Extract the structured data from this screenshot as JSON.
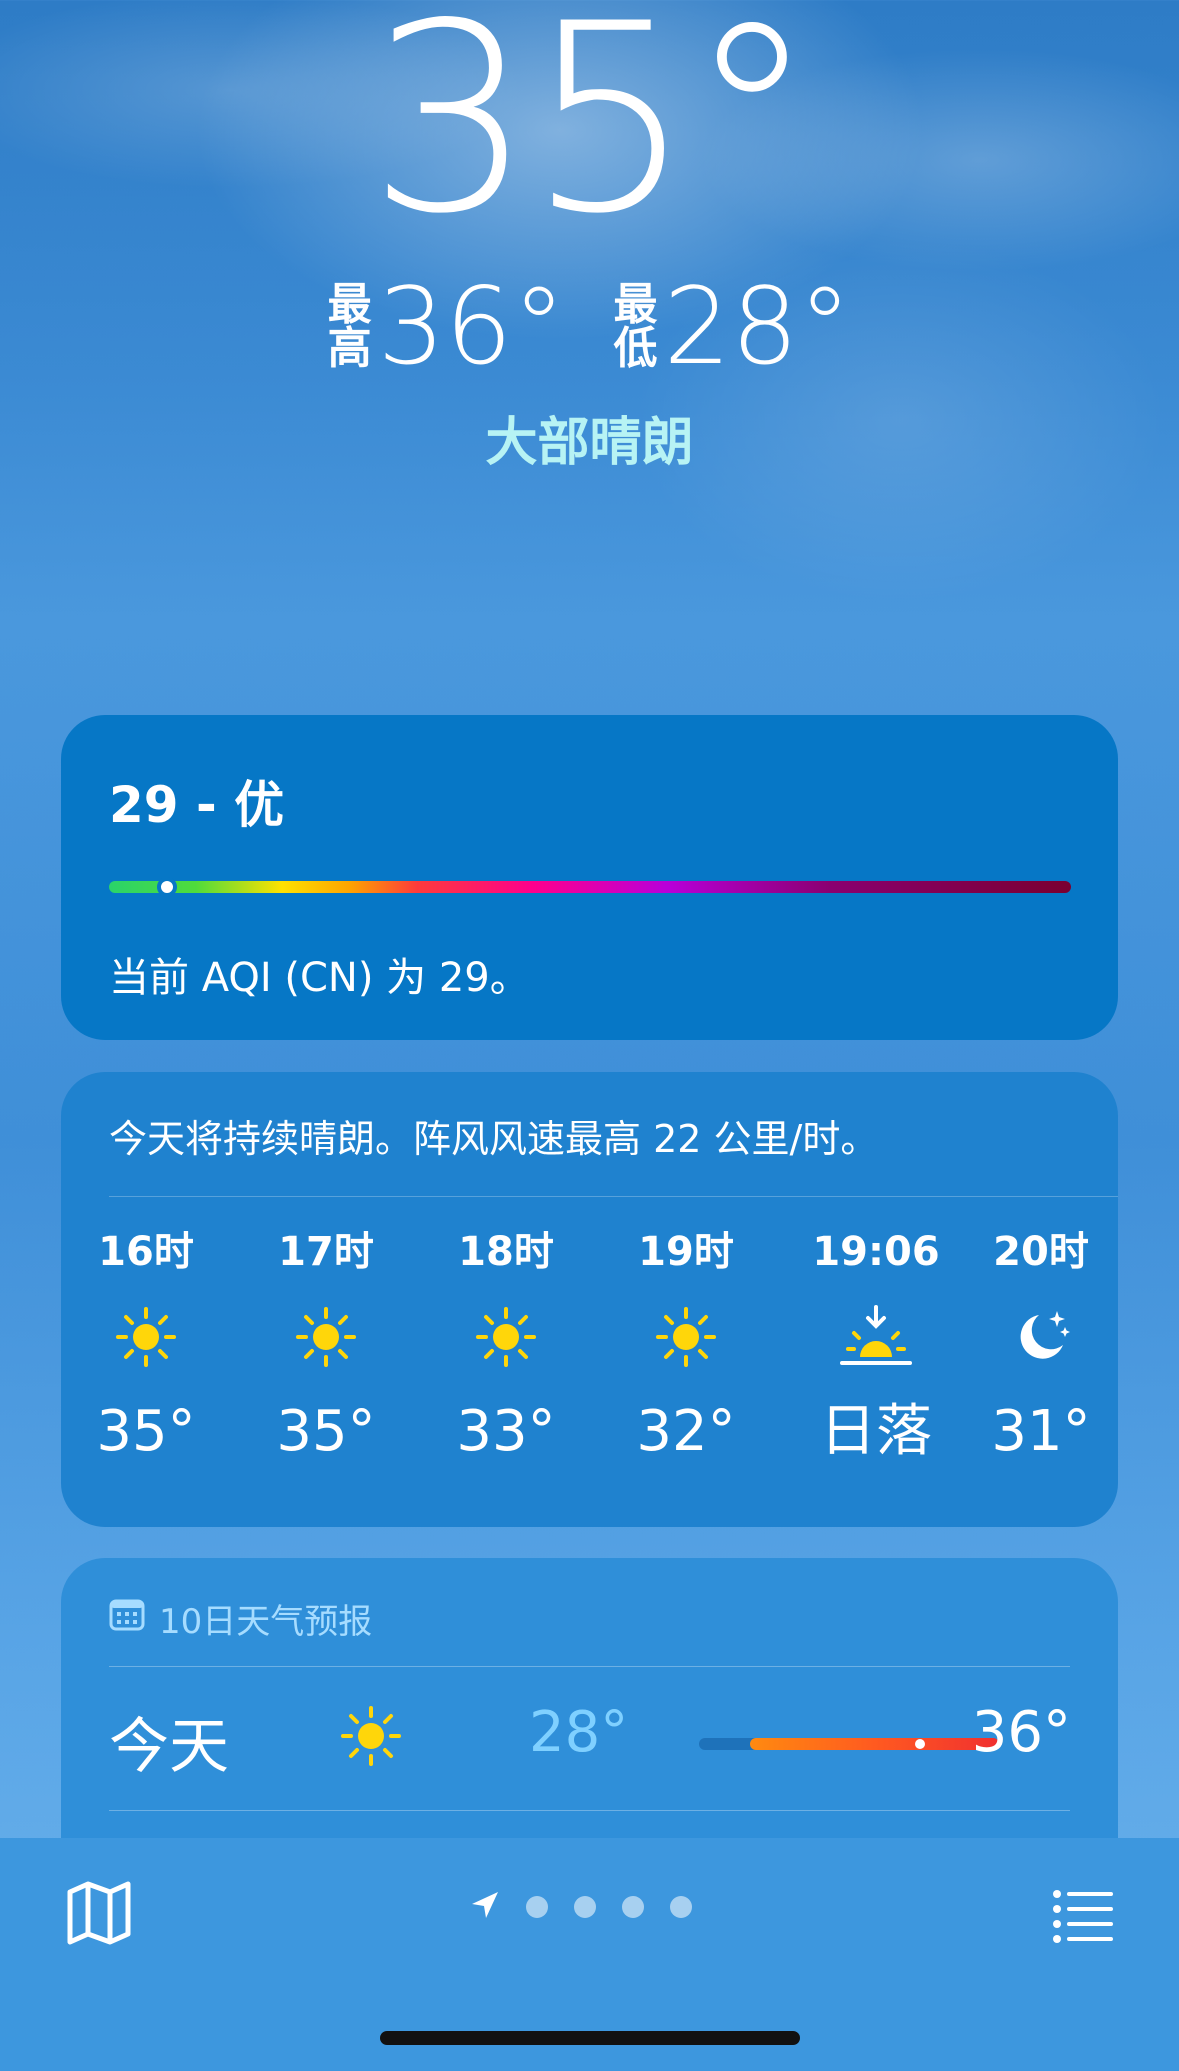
{
  "current": {
    "temperature": "35°",
    "high_label_top": "最",
    "high_label_bottom": "高",
    "high": "36°",
    "low_label_top": "最",
    "low_label_bottom": "低",
    "low": "28°",
    "condition": "大部晴朗"
  },
  "aqi": {
    "title": "29 - 优",
    "description": "当前 AQI (CN) 为 29。",
    "level_fraction": 0.06
  },
  "hourly": {
    "summary": "今天将持续晴朗。阵风风速最高 22 公里/时。",
    "items": [
      {
        "time": "16时",
        "icon": "sun-icon",
        "temp": "35°"
      },
      {
        "time": "17时",
        "icon": "sun-icon",
        "temp": "35°"
      },
      {
        "time": "18时",
        "icon": "sun-icon",
        "temp": "33°"
      },
      {
        "time": "19时",
        "icon": "sun-icon",
        "temp": "32°"
      },
      {
        "time": "19:06",
        "icon": "sunset-icon",
        "temp": "日落"
      },
      {
        "time": "20时",
        "icon": "moon-stars-icon",
        "temp": "31°"
      }
    ]
  },
  "ten_day": {
    "header": "10日天气预报",
    "days": [
      {
        "name": "今天",
        "icon": "sun-icon",
        "low": "28°",
        "high": "36°",
        "range_start": 0.17,
        "range_end": 1.0,
        "current_fraction": 0.72
      }
    ]
  },
  "tabbar": {
    "map_icon": "map-icon",
    "location_icon": "location-arrow-icon",
    "list_icon": "list-icon",
    "page_dots": 4
  },
  "colors": {
    "sun": "#ffd60a",
    "condition": "#b7f3f4",
    "low_temp": "#7fd0ff"
  }
}
